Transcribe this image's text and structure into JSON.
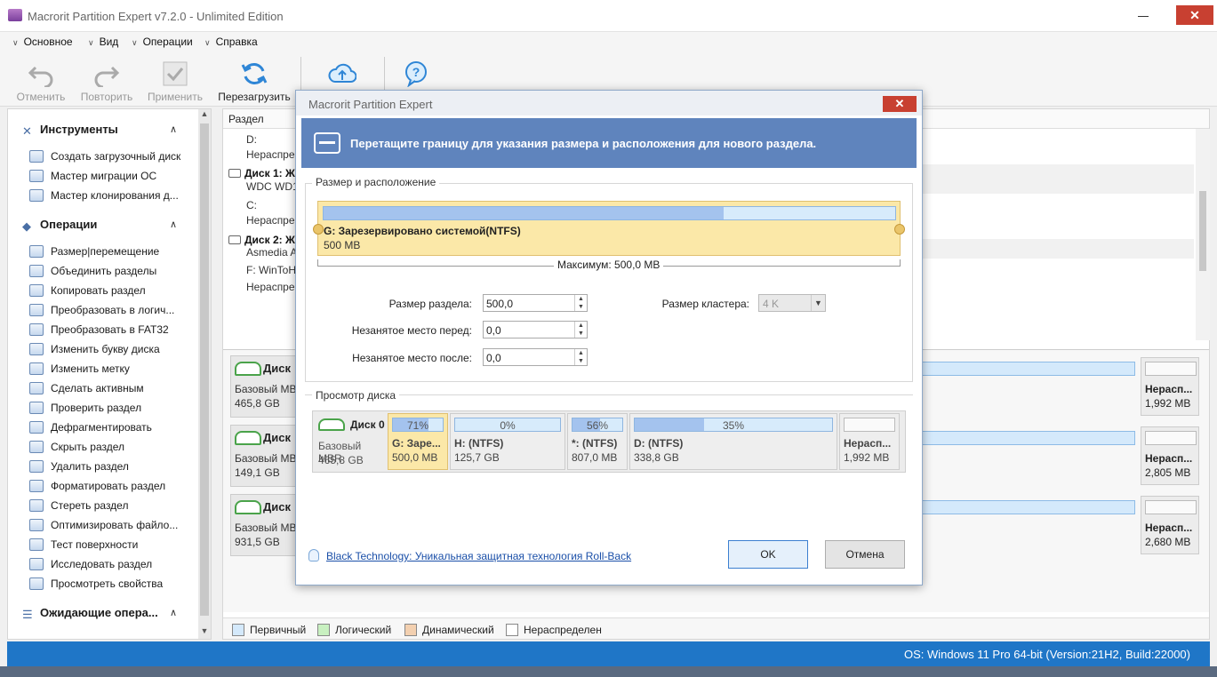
{
  "window": {
    "title": "Macrorit Partition Expert v7.2.0 - Unlimited Edition",
    "close_glyph": "✕",
    "minimize_glyph": "—"
  },
  "menu": [
    "Основное",
    "Вид",
    "Операции",
    "Справка"
  ],
  "toolbar": {
    "undo": "Отменить",
    "redo": "Повторить",
    "apply": "Применить",
    "reload": "Перезагрузить"
  },
  "sidebar": {
    "tools": {
      "title": "Инструменты",
      "items": [
        "Создать загрузочный диск",
        "Мастер миграции ОС",
        "Мастер клонирования д..."
      ]
    },
    "operations": {
      "title": "Операции",
      "items": [
        "Размер|перемещение",
        "Объединить разделы",
        "Копировать раздел",
        "Преобразовать в логич...",
        "Преобразовать в FAT32",
        "Изменить букву диска",
        "Изменить метку",
        "Сделать активным",
        "Проверить раздел",
        "Дефрагментировать",
        "Скрыть раздел",
        "Удалить раздел",
        "Форматировать раздел",
        "Стереть раздел",
        "Оптимизировать файло...",
        "Тест поверхности",
        "Исследовать раздел",
        "Просмотреть свойства"
      ]
    },
    "pending": {
      "title": "Ожидающие опера..."
    }
  },
  "main": {
    "column_partition": "Раздел",
    "rows": [
      {
        "text": "D:",
        "bold": false
      },
      {
        "text": "Нераспре",
        "bold": false
      },
      {
        "text": "Диск 1: Ж",
        "bold": true
      },
      {
        "text": "WDC WD1",
        "bold": false
      },
      {
        "text": "C:",
        "bold": false
      },
      {
        "text": "Нераспре",
        "bold": false
      },
      {
        "text": "Диск 2: Ж",
        "bold": true
      },
      {
        "text": "Asmedia A",
        "bold": false
      },
      {
        "text": "F: WinToH",
        "bold": false
      },
      {
        "text": "Нераспре",
        "bold": false
      }
    ],
    "disks": [
      {
        "name": "Диск",
        "type": "Базовый MBI",
        "size": "465,8 GB",
        "unalloc_label": "Нерасп...",
        "unalloc_size": "1,992 MB"
      },
      {
        "name": "Диск",
        "type": "Базовый MBI",
        "size": "149,1 GB",
        "unalloc_label": "Нерасп...",
        "unalloc_size": "2,805 MB"
      },
      {
        "name": "Диск",
        "type": "Базовый MBI",
        "size": "931,5 GB",
        "unalloc_label": "Нерасп...",
        "unalloc_size": "2,680 MB"
      }
    ],
    "legend": [
      {
        "label": "Первичный",
        "color": "#d4e9fb"
      },
      {
        "label": "Логический",
        "color": "#c8f0c0"
      },
      {
        "label": "Динамический",
        "color": "#f3d0b0"
      },
      {
        "label": "Нераспределен",
        "color": "#ffffff"
      }
    ]
  },
  "status": {
    "os": "OS: Windows 11 Pro 64-bit (Version:21H2, Build:22000)"
  },
  "dialog": {
    "title": "Macrorit Partition Expert",
    "banner": "Перетащите границу для указания размера и расположения для нового раздела.",
    "group_size": "Размер и расположение",
    "partition_name": "G: Зарезервировано системой(NTFS)",
    "partition_size": "500 MB",
    "partition_fill": 0.7,
    "maximum": "Максимум: 500,0 MB",
    "fields": {
      "size_label": "Размер раздела:",
      "size_value": "500,0",
      "before_label": "Незанятое место перед:",
      "before_value": "0,0",
      "after_label": "Незанятое место после:",
      "after_value": "0,0",
      "cluster_label": "Размер кластера:",
      "cluster_value": "4 K"
    },
    "group_preview": "Просмотр диска",
    "preview": {
      "disk_name": "Диск 0",
      "disk_type": "Базовый MBR",
      "disk_size": "465,8 GB",
      "partitions": [
        {
          "pct": "71%",
          "fill": 0.71,
          "name": "G: Заре...",
          "size": "500,0 MB",
          "selected": true
        },
        {
          "pct": "0%",
          "fill": 0.0,
          "name": "H: (NTFS)",
          "size": "125,7 GB",
          "selected": false
        },
        {
          "pct": "56%",
          "fill": 0.56,
          "name": "*: (NTFS)",
          "size": "807,0 MB",
          "selected": false
        },
        {
          "pct": "35%",
          "fill": 0.35,
          "name": "D: (NTFS)",
          "size": "338,8 GB",
          "selected": false
        },
        {
          "pct": "",
          "fill": 0.0,
          "name": "Нерасп...",
          "size": "1,992 MB",
          "selected": false,
          "unallocated": true
        }
      ]
    },
    "link": "Black Technology: Уникальная защитная технология Roll-Back",
    "ok": "OK",
    "cancel": "Отмена"
  }
}
